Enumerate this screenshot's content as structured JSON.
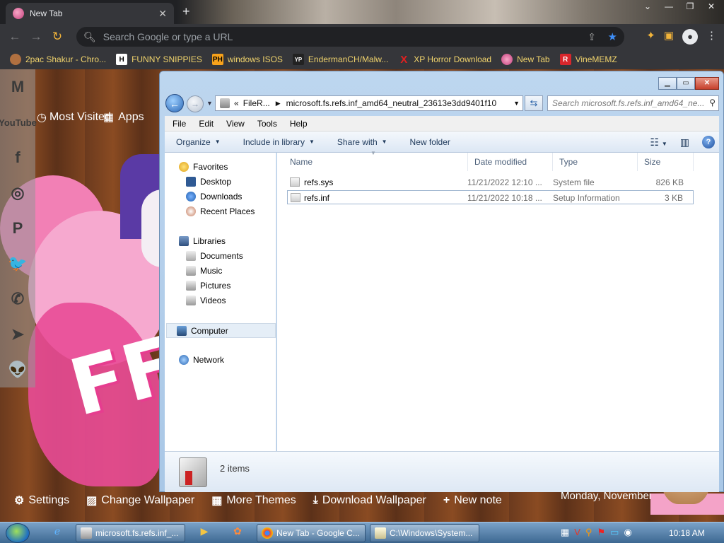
{
  "browser": {
    "tab_title": "New Tab",
    "omnibox_placeholder": "Search Google or type a URL",
    "bookmarks": [
      "2pac Shakur - Chro...",
      "FUNNY SNIPPIES",
      "windows ISOS",
      "EndermanCH/Malw...",
      "XP Horror Download",
      "New Tab",
      "VineMEMZ"
    ],
    "bookmark_icon_text": [
      "",
      "H",
      "PH",
      "YP",
      "X",
      "",
      "R"
    ]
  },
  "ntp": {
    "most_visited": "Most Visited",
    "apps": "Apps",
    "social": [
      "M",
      "YouTube",
      "f",
      "◎",
      "P",
      "🐦",
      "✆",
      "➤",
      "👽"
    ],
    "bottom": [
      "Settings",
      "Change Wallpaper",
      "More Themes",
      "Download Wallpaper",
      "New note"
    ],
    "date": "Monday, November"
  },
  "explorer": {
    "address_prefix": "«",
    "address_crumb1": "FileR...",
    "address_crumb2": "microsoft.fs.refs.inf_amd64_neutral_23613e3dd9401f10",
    "search_placeholder": "Search microsoft.fs.refs.inf_amd64_ne...",
    "menu": [
      "File",
      "Edit",
      "View",
      "Tools",
      "Help"
    ],
    "commands": [
      "Organize",
      "Include in library",
      "Share with",
      "New folder"
    ],
    "nav": {
      "favorites": "Favorites",
      "desktop": "Desktop",
      "downloads": "Downloads",
      "recent": "Recent Places",
      "libraries": "Libraries",
      "documents": "Documents",
      "music": "Music",
      "pictures": "Pictures",
      "videos": "Videos",
      "computer": "Computer",
      "network": "Network"
    },
    "columns": [
      "Name",
      "Date modified",
      "Type",
      "Size"
    ],
    "files": [
      {
        "name": "refs.sys",
        "date": "11/21/2022 12:10 ...",
        "type": "System file",
        "size": "826 KB"
      },
      {
        "name": "refs.inf",
        "date": "11/21/2022 10:18 ...",
        "type": "Setup Information",
        "size": "3 KB"
      }
    ],
    "item_count": "2 items"
  },
  "taskbar": {
    "buttons": [
      "microsoft.fs.refs.inf_...",
      "New Tab - Google C...",
      "C:\\Windows\\System..."
    ],
    "clock": "10:18 AM"
  }
}
